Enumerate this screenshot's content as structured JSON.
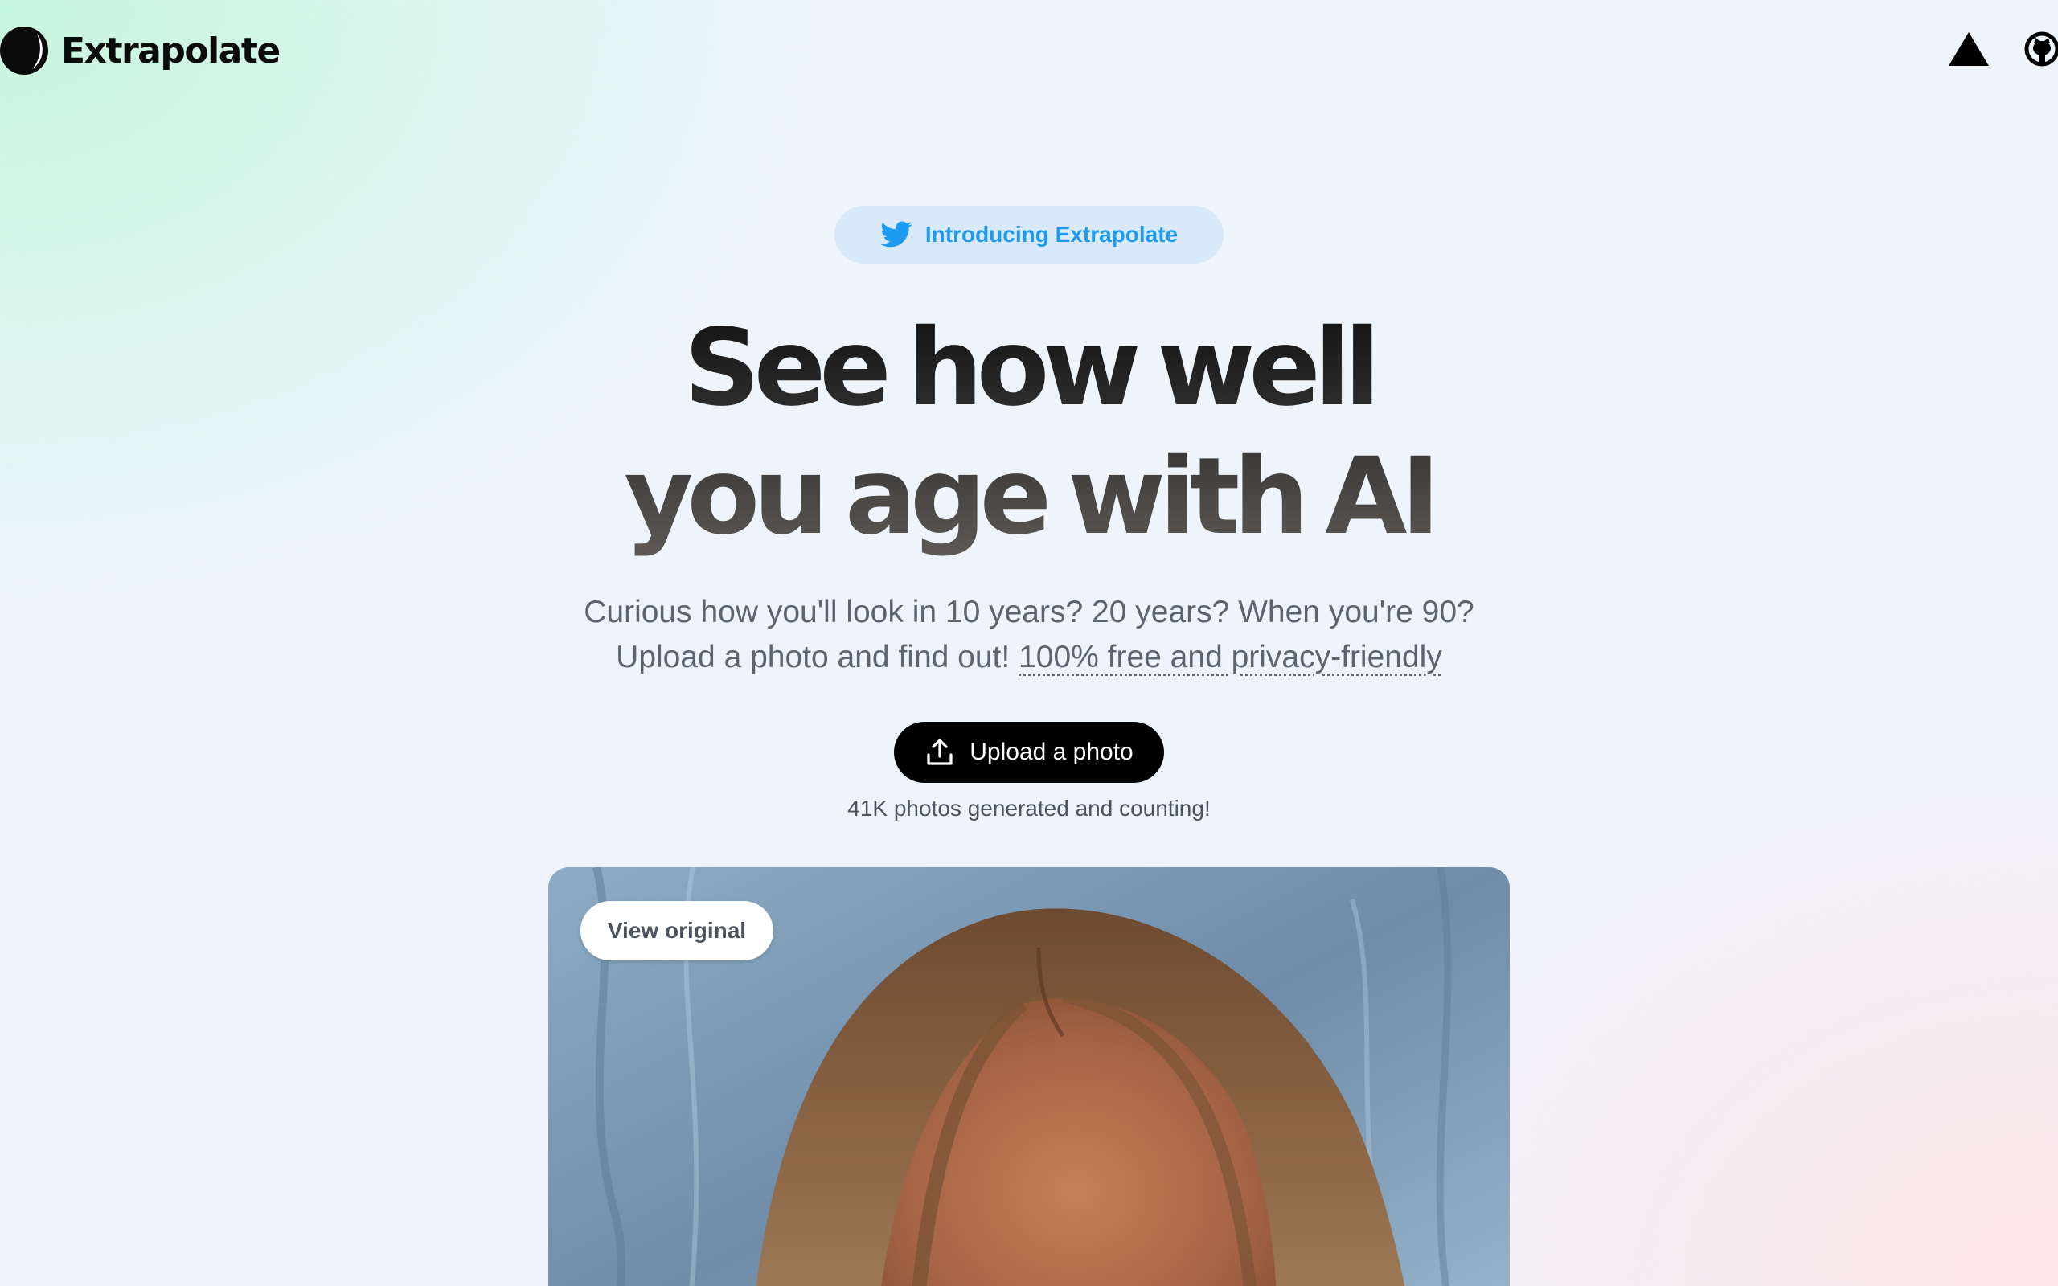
{
  "header": {
    "brand_name": "Extrapolate",
    "logo_icon": "crescent-moon-logo",
    "actions": [
      {
        "icon": "vercel-triangle-icon"
      },
      {
        "icon": "github-icon"
      }
    ]
  },
  "announcement": {
    "icon": "twitter-bird-icon",
    "label": "Introducing Extrapolate",
    "color": "#1d9bf0",
    "background": "#d8e9fb"
  },
  "hero": {
    "headline_line1": "See how well",
    "headline_line2": "you age with AI",
    "subtitle_line1": "Curious how you'll look in 10 years? 20 years? When you're 90?",
    "subtitle_line2_prefix": "Upload a photo and find out!",
    "subtitle_link": "100% free and privacy-friendly"
  },
  "upload": {
    "icon": "upload-icon",
    "label": "Upload a photo"
  },
  "counter_text": "41K photos generated and counting!",
  "preview": {
    "view_original_label": "View original",
    "image_description": "portrait-photo"
  },
  "colors": {
    "text_primary": "#111111",
    "text_muted": "#5c6472",
    "button_bg": "#000000",
    "button_text": "#ffffff"
  }
}
